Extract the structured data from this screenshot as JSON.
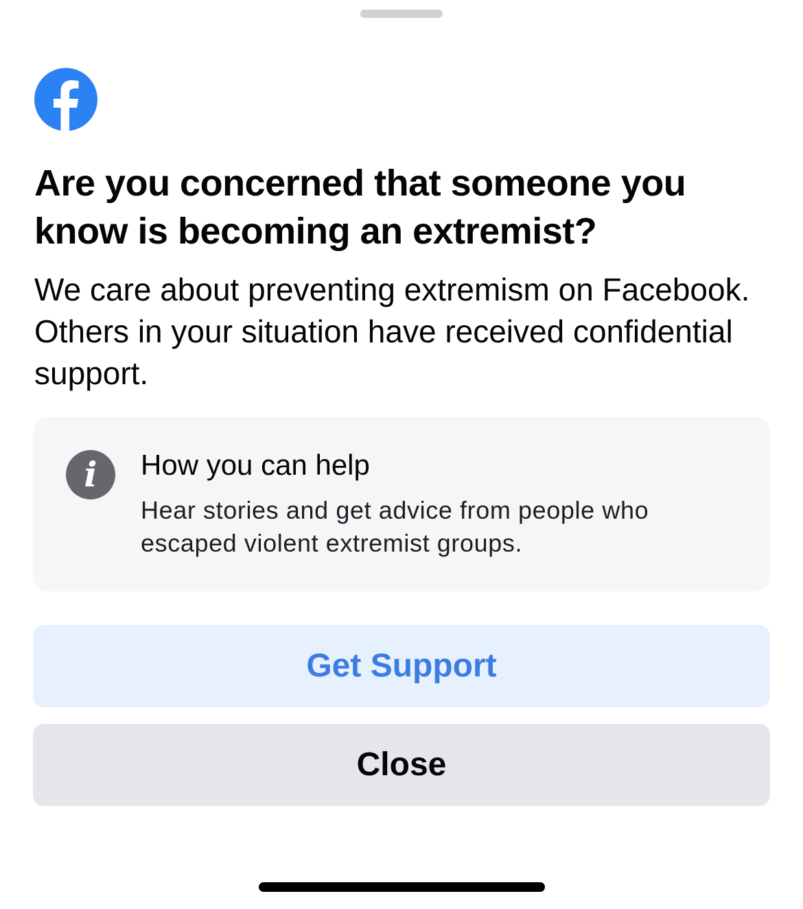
{
  "sheet": {
    "grabber_icon": "drag-handle",
    "logo_icon": "facebook-logo",
    "brand_color": "#1877f2",
    "headline": "Are you concerned that someone you know is becoming an extremist?",
    "body": "We care about preventing extremism on Facebook. Others in your situation have received confidential support."
  },
  "info_card": {
    "icon": "info-icon",
    "icon_glyph": "i",
    "title": "How you can help",
    "description": "Hear stories and get advice from people who escaped violent extremist groups."
  },
  "actions": {
    "primary_label": "Get Support",
    "primary_color": "#3b7de3",
    "primary_bg": "#e7f0fd",
    "secondary_label": "Close",
    "secondary_bg": "#e4e6eb"
  },
  "system": {
    "home_indicator": "home-indicator"
  }
}
